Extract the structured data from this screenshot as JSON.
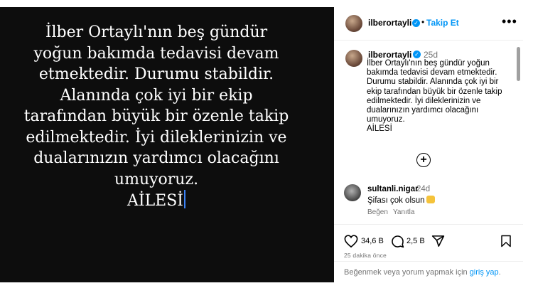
{
  "post": {
    "lines": [
      "İlber Ortaylı'nın beş gündür",
      "yoğun bakımda tedavisi devam",
      "etmektedir. Durumu stabildir.",
      "Alanında çok iyi bir ekip",
      "tarafından büyük bir özenle takip",
      "edilmektedir. İyi dileklerinizin ve",
      "dualarınızın yardımcı olacağını",
      "umuyoruz.",
      "AİLESİ"
    ]
  },
  "header": {
    "username": "ilberortayli",
    "verified_icon": "✓",
    "separator": "•",
    "follow_label": "Takip Et",
    "more_icon": "•••"
  },
  "caption": {
    "username": "ilberortayli",
    "time": "25d",
    "lines": [
      "İlber Ortaylı'nın beş gündür yoğun",
      "bakımda tedavisi devam etmektedir.",
      "Durumu stabildir. Alanında çok iyi bir",
      "ekip tarafından büyük bir özenle takip",
      "edilmektedir. İyi dileklerinizin ve",
      "dualarınızın yardımcı olacağını",
      "umuyoruz.",
      "AİLESİ"
    ],
    "load_more_icon": "+"
  },
  "comment": {
    "username": "sultanli.nigar",
    "time": "24d",
    "text": "Şifası çok olsun",
    "like_label": "Beğen",
    "reply_label": "Yanıtla"
  },
  "actions": {
    "likes": "34,6 B",
    "comments": "2,5 B"
  },
  "meta": {
    "time_ago": "25 dakika önce"
  },
  "footer": {
    "prompt": "Beğenmek veya yorum yapmak için ",
    "login_link": "giriş yap",
    "suffix": "."
  },
  "colors": {
    "accent": "#0095f6",
    "media_bg": "#0d0d0d",
    "muted": "#737373"
  }
}
